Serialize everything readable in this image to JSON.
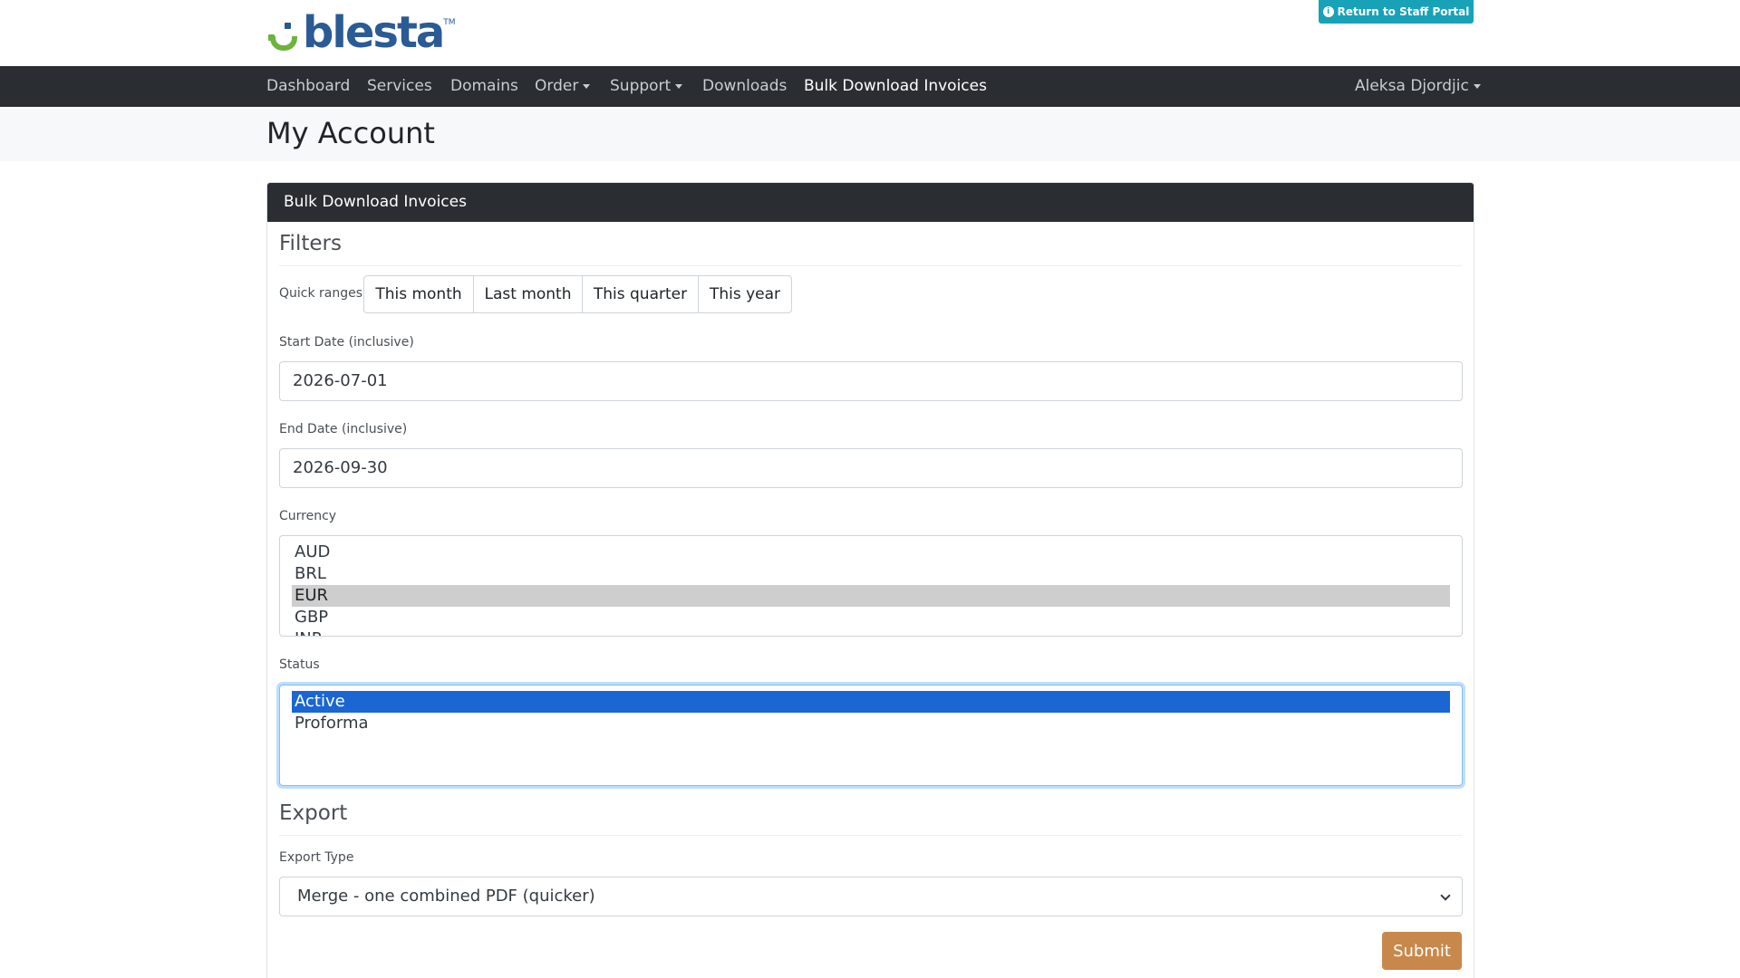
{
  "brand": {
    "name": "blesta",
    "tm": "TM",
    "colors": {
      "blue": "#2a5b95",
      "green": "#6db33f"
    }
  },
  "header": {
    "staff_portal_button": "Return to Staff Portal",
    "staff_icon": "info-circle-icon",
    "button_color": "#17a2b8"
  },
  "nav": {
    "items": [
      {
        "label": "Dashboard",
        "dropdown": false
      },
      {
        "label": "Services",
        "dropdown": false
      },
      {
        "label": "Domains",
        "dropdown": false
      },
      {
        "label": "Order",
        "dropdown": true
      },
      {
        "label": "Support",
        "dropdown": true
      },
      {
        "label": "Downloads",
        "dropdown": false
      },
      {
        "label": "Bulk Download Invoices",
        "dropdown": false,
        "active": true
      }
    ],
    "user": "Aleksa Djordjic",
    "background": "#2a2e33"
  },
  "page": {
    "title": "My Account"
  },
  "card": {
    "header": "Bulk Download Invoices",
    "filters": {
      "title": "Filters",
      "quick_ranges_label": "Quick ranges",
      "quick_ranges": [
        "This month",
        "Last month",
        "This quarter",
        "This year"
      ],
      "start_date_label": "Start Date (inclusive)",
      "start_date_value": "2026-07-01",
      "end_date_label": "End Date (inclusive)",
      "end_date_value": "2026-09-30",
      "currency_label": "Currency",
      "currency_options": [
        "AUD",
        "BRL",
        "EUR",
        "GBP",
        "INR"
      ],
      "currency_selected": "EUR",
      "status_label": "Status",
      "status_options": [
        "Active",
        "Proforma"
      ],
      "status_selected": "Active"
    },
    "export": {
      "title": "Export",
      "type_label": "Export Type",
      "type_value": "Merge - one combined PDF (quicker)"
    },
    "submit_label": "Submit",
    "submit_color": "#c8884b"
  }
}
